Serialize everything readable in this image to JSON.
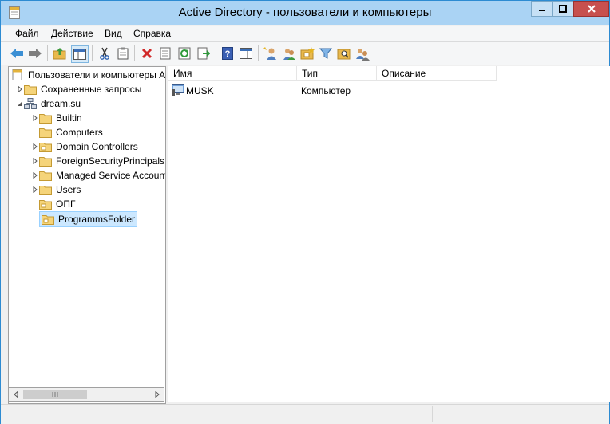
{
  "window": {
    "title": "Active Directory - пользователи и компьютеры"
  },
  "menu": [
    "Файл",
    "Действие",
    "Вид",
    "Справка"
  ],
  "toolbar_icons": [
    "back-icon",
    "forward-icon",
    "up-folder-icon",
    "show-console-tree-icon",
    "cut-icon",
    "copy-icon",
    "delete-icon",
    "properties-icon",
    "refresh-icon",
    "export-list-icon",
    "help-icon",
    "show-action-pane-icon",
    "new-user-icon",
    "new-group-icon",
    "new-ou-icon",
    "filter-icon",
    "find-icon",
    "add-to-group-icon"
  ],
  "tree": {
    "root": "Пользователи и компьютеры Active Directory",
    "saved_queries": "Сохраненные запросы",
    "domain": "dream.su",
    "children": [
      "Builtin",
      "Computers",
      "Domain Controllers",
      "ForeignSecurityPrincipals",
      "Managed Service Accounts",
      "Users",
      "ОПГ",
      "ProgrammsFolder"
    ]
  },
  "list": {
    "columns": [
      "Имя",
      "Тип",
      "Описание"
    ],
    "rows": [
      {
        "name": "MUSK",
        "type": "Компьютер",
        "description": ""
      }
    ]
  },
  "colors": {
    "titlebar": "#aad3f4",
    "close": "#c7504e",
    "selection": "#cce8ff"
  }
}
